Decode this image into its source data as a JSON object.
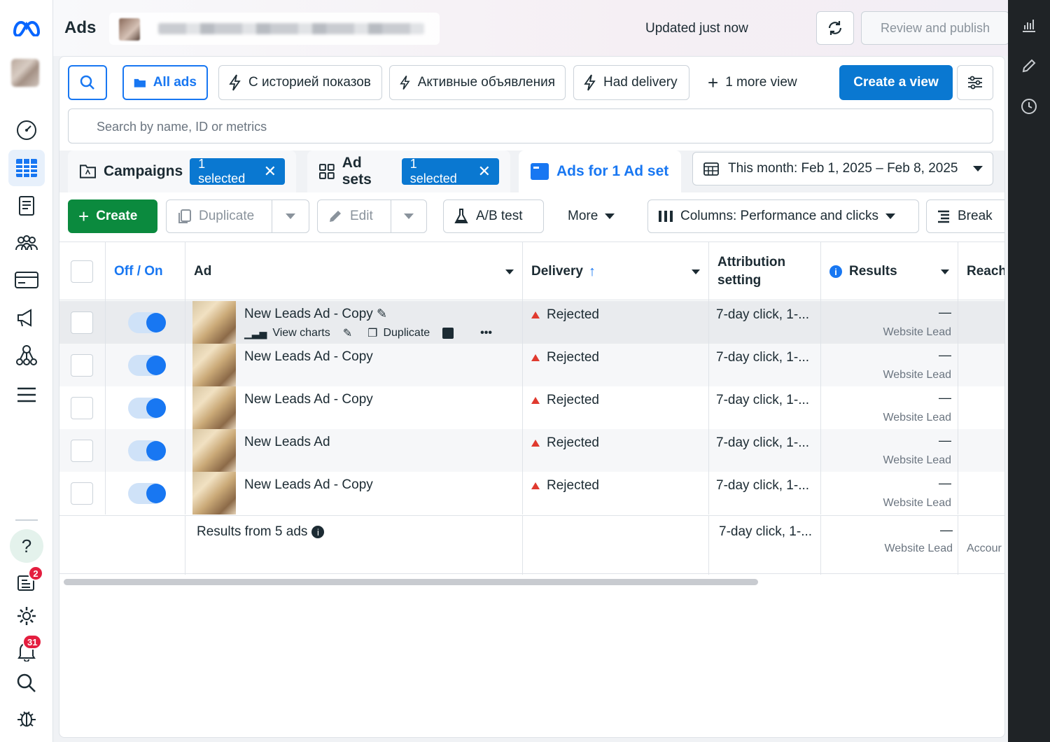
{
  "app": {
    "title": "Ads"
  },
  "header": {
    "updated_text": "Updated just now",
    "review_label": "Review and publish",
    "more_label": "•••"
  },
  "views": {
    "all_ads": "All ads",
    "view1": "С историей показов",
    "view2": "Активные объявления",
    "view3": "Had delivery",
    "more_views": "1 more view",
    "create_view": "Create a view"
  },
  "search": {
    "placeholder": "Search by name, ID or metrics"
  },
  "tabs": {
    "campaigns": {
      "label": "Campaigns",
      "chip": "1 selected"
    },
    "adsets": {
      "label": "Ad sets",
      "chip": "1 selected"
    },
    "ads": {
      "label": "Ads for 1 Ad set"
    }
  },
  "date_range": {
    "label": "This month: Feb 1, 2025 – Feb 8, 2025"
  },
  "toolbar": {
    "create": "Create",
    "duplicate": "Duplicate",
    "edit": "Edit",
    "ab_test": "A/B test",
    "more": "More",
    "columns": "Columns: Performance and clicks",
    "breakdown": "Break"
  },
  "table": {
    "headers": {
      "toggle": "Off / On",
      "ad": "Ad",
      "delivery": "Delivery",
      "attribution": "Attribution setting",
      "results": "Results",
      "reach": "Reach"
    },
    "rows": [
      {
        "name": "New Leads Ad - Copy",
        "delivery": "Rejected",
        "attribution": "7-day click, 1-...",
        "result": "—",
        "result_label": "Website Lead"
      },
      {
        "name": "New Leads Ad - Copy",
        "delivery": "Rejected",
        "attribution": "7-day click, 1-...",
        "result": "—",
        "result_label": "Website Lead"
      },
      {
        "name": "New Leads Ad - Copy",
        "delivery": "Rejected",
        "attribution": "7-day click, 1-...",
        "result": "—",
        "result_label": "Website Lead"
      },
      {
        "name": "New Leads Ad",
        "delivery": "Rejected",
        "attribution": "7-day click, 1-...",
        "result": "—",
        "result_label": "Website Lead"
      },
      {
        "name": "New Leads Ad - Copy",
        "delivery": "Rejected",
        "attribution": "7-day click, 1-...",
        "result": "—",
        "result_label": "Website Lead"
      }
    ],
    "row_actions": {
      "view_charts": "View charts",
      "duplicate": "Duplicate",
      "more": "•••"
    },
    "summary": {
      "label": "Results from 5 ads",
      "attribution": "7-day click, 1-...",
      "result": "—",
      "result_label": "Website Lead",
      "reach": "Accour"
    }
  },
  "nav": {
    "notifications_badge": "2",
    "alerts_badge": "31",
    "help": "?"
  },
  "colors": {
    "primary": "#0a78d1",
    "green": "#0b8a3e",
    "rejected": "#e03a2f",
    "meta_blue": "#0866ff"
  }
}
